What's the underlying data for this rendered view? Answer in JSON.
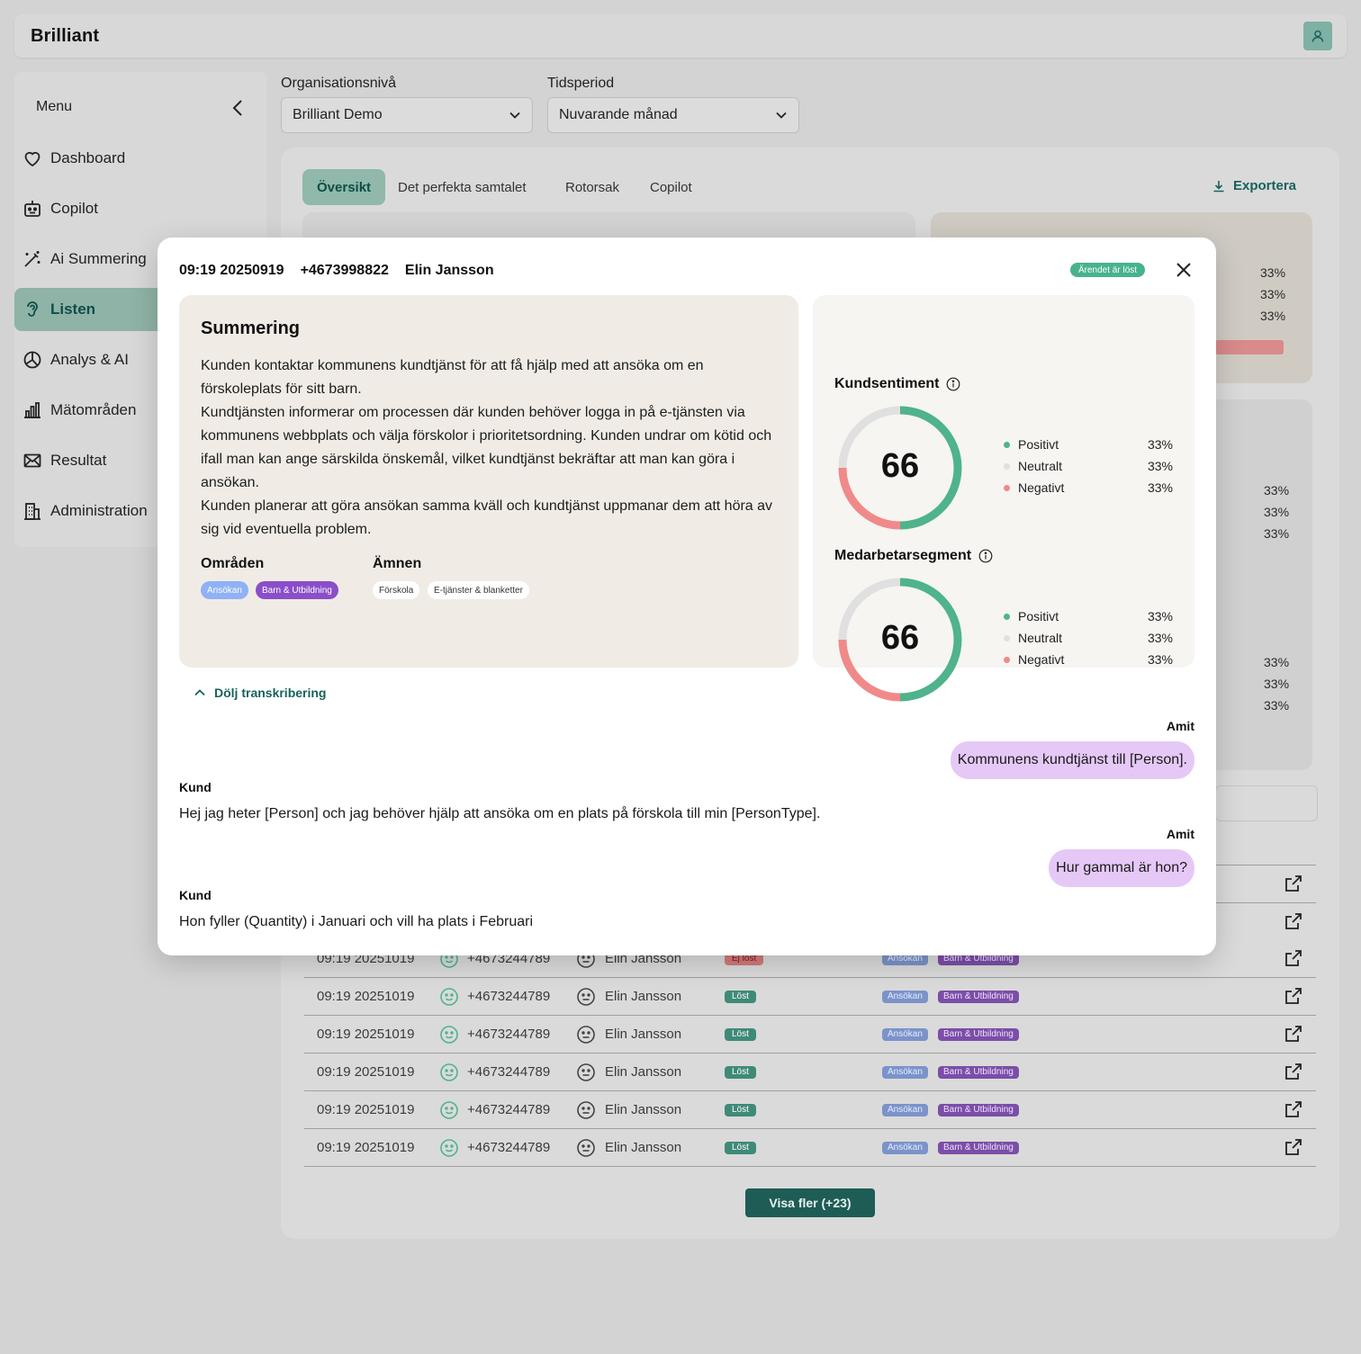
{
  "app": {
    "logo": "Brilliant"
  },
  "sidebar": {
    "menu_label": "Menu",
    "items": [
      {
        "label": "Dashboard",
        "icon": "heart-icon",
        "active": false
      },
      {
        "label": "Copilot",
        "icon": "robot-icon",
        "active": false
      },
      {
        "label": "Ai Summering",
        "icon": "magic-wand-icon",
        "active": false
      },
      {
        "label": "Listen",
        "icon": "ear-icon",
        "active": true
      },
      {
        "label": "Analys & AI",
        "icon": "pie-chart-icon",
        "active": false
      },
      {
        "label": "Mätområden",
        "icon": "bar-chart-icon",
        "active": false
      },
      {
        "label": "Resultat",
        "icon": "mail-icon",
        "active": false
      },
      {
        "label": "Administration",
        "icon": "building-icon",
        "active": false
      }
    ]
  },
  "filters": {
    "org_label": "Organisationsnivå",
    "org_value": "Brilliant Demo",
    "period_label": "Tidsperiod",
    "period_value": "Nuvarande månad"
  },
  "tabs": [
    {
      "label": "Översikt",
      "active": true
    },
    {
      "label": "Det perfekta samtalet",
      "active": false
    },
    {
      "label": "Rotorsak",
      "active": false
    },
    {
      "label": "Copilot",
      "active": false
    }
  ],
  "export_label": "Exportera",
  "background_percentages": [
    "33%",
    "33%",
    "33%",
    "33%",
    "33%",
    "33%",
    "33%",
    "33%",
    "33%"
  ],
  "table": {
    "rows": [
      {
        "time": "09:19 20251019",
        "phone": "+4673244789",
        "agent": "Elin Jansson",
        "status": "Ej löst",
        "resolved": false,
        "tags": [
          "Ansökan",
          "Barn & Utbildning"
        ]
      },
      {
        "time": "09:19 20251019",
        "phone": "+4673244789",
        "agent": "Elin Jansson",
        "status": "Löst",
        "resolved": true,
        "tags": [
          "Ansökan",
          "Barn & Utbildning"
        ]
      },
      {
        "time": "09:19 20251019",
        "phone": "+4673244789",
        "agent": "Elin Jansson",
        "status": "Löst",
        "resolved": true,
        "tags": [
          "Ansökan",
          "Barn & Utbildning"
        ]
      },
      {
        "time": "09:19 20251019",
        "phone": "+4673244789",
        "agent": "Elin Jansson",
        "status": "Löst",
        "resolved": true,
        "tags": [
          "Ansökan",
          "Barn & Utbildning"
        ]
      },
      {
        "time": "09:19 20251019",
        "phone": "+4673244789",
        "agent": "Elin Jansson",
        "status": "Löst",
        "resolved": true,
        "tags": [
          "Ansökan",
          "Barn & Utbildning"
        ]
      },
      {
        "time": "09:19 20251019",
        "phone": "+4673244789",
        "agent": "Elin Jansson",
        "status": "Löst",
        "resolved": true,
        "tags": [
          "Ansökan",
          "Barn & Utbildning"
        ]
      }
    ],
    "show_more": "Visa fler (+23)"
  },
  "modal": {
    "time": "09:19 20250919",
    "phone": "+4673998822",
    "agent": "Elin Jansson",
    "status_badge": "Ärendet är löst",
    "summary": {
      "title": "Summering",
      "paragraphs": [
        "Kunden kontaktar kommunens kundtjänst för att få hjälp med att ansöka om en förskoleplats för sitt barn.",
        "Kundtjänsten informerar om processen där kunden behöver logga in på e-tjänsten via kommunens webbplats och välja förskolor i prioritetsordning. Kunden undrar om kötid och ifall man kan ange särskilda önskemål, vilket kundtjänst bekräftar att man kan göra i ansökan.",
        "Kunden planerar att göra ansökan samma kväll och kundtjänst uppmanar dem att höra av sig vid eventuella problem."
      ],
      "areas_label": "Områden",
      "areas": [
        "Ansökan",
        "Barn & Utbildning"
      ],
      "topics_label": "Ämnen",
      "topics": [
        "Förskola",
        "E-tjänster & blanketter"
      ]
    },
    "sentiment": [
      {
        "title": "Kundsentiment",
        "score": "66",
        "share": {
          "positive": 0.5,
          "negative": 0.25,
          "neutral": 0.25
        },
        "legend": [
          {
            "label": "Positivt",
            "value": "33%",
            "color": "#4fb38b"
          },
          {
            "label": "Neutralt",
            "value": "33%",
            "color": "#e0e0e0"
          },
          {
            "label": "Negativt",
            "value": "33%",
            "color": "#f08a8a"
          }
        ]
      },
      {
        "title": "Medarbetarsegment",
        "score": "66",
        "share": {
          "positive": 0.5,
          "negative": 0.25,
          "neutral": 0.25
        },
        "legend": [
          {
            "label": "Positivt",
            "value": "33%",
            "color": "#4fb38b"
          },
          {
            "label": "Neutralt",
            "value": "33%",
            "color": "#e0e0e0"
          },
          {
            "label": "Negativt",
            "value": "33%",
            "color": "#f08a8a"
          }
        ]
      }
    ],
    "toggle_transcript": "Dölj transkribering",
    "transcript": [
      {
        "speaker": "Amit",
        "text": "Kommunens kundtjänst till [Person]."
      },
      {
        "speaker": "Kund",
        "text": "Hej jag heter [Person] och jag behöver hjälp att ansöka om en plats på förskola till min [PersonType]."
      },
      {
        "speaker": "Amit",
        "text": "Hur gammal är hon?"
      },
      {
        "speaker": "Kund",
        "text": "Hon fyller (Quantity) i Januari och vill ha plats i Februari"
      }
    ]
  }
}
